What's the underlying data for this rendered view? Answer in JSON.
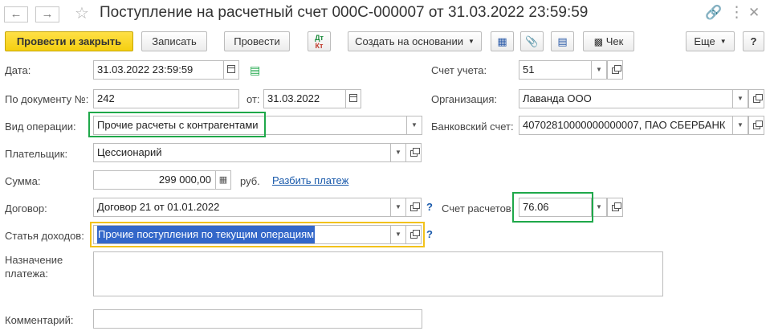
{
  "window": {
    "title": "Поступление на расчетный счет 000С-000007 от 31.03.2022 23:59:59"
  },
  "toolbar": {
    "post_and_close": "Провести и закрыть",
    "save": "Записать",
    "post": "Провести",
    "dtkt_top": "Дт",
    "dtkt_bottom": "Кт",
    "create_based_on": "Создать на основании",
    "check": "Чек",
    "more": "Еще",
    "help": "?"
  },
  "form": {
    "date": {
      "label": "Дата:",
      "value": "31.03.2022 23:59:59"
    },
    "doc_number": {
      "label": "По документу №:",
      "value": "242",
      "from_label": "от:",
      "from_value": "31.03.2022"
    },
    "operation": {
      "label": "Вид операции:",
      "value": "Прочие расчеты с контрагентами"
    },
    "payer": {
      "label": "Плательщик:",
      "value": "Цессионарий"
    },
    "amount": {
      "label": "Сумма:",
      "value": "299 000,00",
      "currency": "руб.",
      "split_link": "Разбить платеж"
    },
    "contract": {
      "label": "Договор:",
      "value": "Договор 21 от 01.01.2022"
    },
    "income_item": {
      "label": "Статья доходов:",
      "value": "Прочие поступления по текущим операциям"
    },
    "purpose": {
      "label_line1": "Назначение",
      "label_line2": "платежа:",
      "value": ""
    },
    "comment": {
      "label": "Комментарий:",
      "value": ""
    },
    "account": {
      "label": "Счет учета:",
      "value": "51"
    },
    "organization": {
      "label": "Организация:",
      "value": "Лаванда ООО"
    },
    "bank_account": {
      "label": "Банковский счет:",
      "value": "40702810000000000007, ПАО СБЕРБАНК"
    },
    "settlement_account": {
      "label": "Счет расчетов:",
      "value": "76.06"
    },
    "question_mark": "?"
  },
  "colors": {
    "highlight_green": "#1fa84a",
    "highlight_yellow": "#f2c21b",
    "primary_button": "#f5cf10",
    "link": "#1a5aab",
    "selection": "#3367c9"
  }
}
